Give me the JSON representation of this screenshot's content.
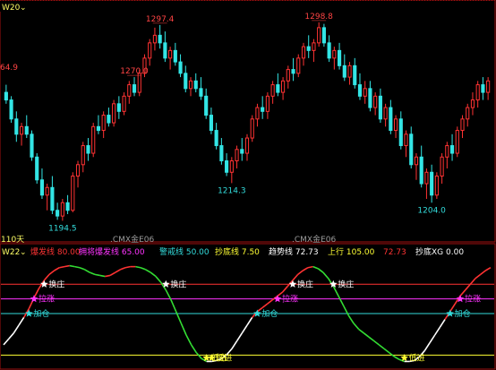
{
  "top_panel": {
    "name": "W20",
    "period_label": "110天",
    "symbol_watermark": ".CMX金E06",
    "peak_labels": [
      {
        "text": "1297.4",
        "type": "high"
      },
      {
        "text": "1298.8",
        "type": "high"
      },
      {
        "text": "1270.0",
        "type": "high"
      },
      {
        "text": "64.9",
        "type": "high"
      },
      {
        "text": "1194.5",
        "type": "low"
      },
      {
        "text": "1214.3",
        "type": "low"
      },
      {
        "text": "1204.0",
        "type": "low"
      }
    ]
  },
  "bottom_panel": {
    "name": "W22",
    "indicators": [
      {
        "label": "爆发线",
        "value": "80.00",
        "color": "#ff3333"
      },
      {
        "label": "拥将爆发线",
        "value": "65.00",
        "color": "#ff33ff"
      },
      {
        "label": "警戒线",
        "value": "50.00",
        "color": "#33dddd"
      },
      {
        "label": "抄底线",
        "value": "7.50",
        "color": "#ffff33"
      },
      {
        "label": "趋势线",
        "value": "72.73",
        "color": "#ffffff"
      },
      {
        "label": "上行",
        "value": "105.00",
        "color": "#ffff33"
      },
      {
        "label": "",
        "value": "72.73",
        "color": "#ff3333"
      },
      {
        "label": "抄底XG",
        "value": "0.00",
        "color": "#ffffff"
      }
    ],
    "levels": [
      {
        "name": "爆发线",
        "value": 80,
        "color": "#ff3333"
      },
      {
        "name": "拥将爆发线",
        "value": 65,
        "color": "#ff33ff"
      },
      {
        "name": "警戒线",
        "value": 50,
        "color": "#33dddd"
      },
      {
        "name": "抄底线",
        "value": 7.5,
        "color": "#ffff33"
      }
    ],
    "signals": [
      {
        "text": "换庄",
        "color": "#ffffff",
        "star": "#ffffff"
      },
      {
        "text": "换庄",
        "color": "#ffffff",
        "star": "#ffffff"
      },
      {
        "text": "换庄",
        "color": "#ffffff",
        "star": "#ffffff"
      },
      {
        "text": "换庄",
        "color": "#ffffff",
        "star": "#ffffff"
      },
      {
        "text": "拉涨",
        "color": "#ff33ff",
        "star": "#ff33ff"
      },
      {
        "text": "拉涨",
        "color": "#ff33ff",
        "star": "#ff33ff"
      },
      {
        "text": "拉涨",
        "color": "#ff33ff",
        "star": "#ff33ff"
      },
      {
        "text": "加仓",
        "color": "#33dddd",
        "star": "#33dddd"
      },
      {
        "text": "加仓",
        "color": "#33dddd",
        "star": "#33dddd"
      },
      {
        "text": "加仓",
        "color": "#33dddd",
        "star": "#33dddd"
      },
      {
        "text": "加仓",
        "color": "#33dddd",
        "star": "#33dddd"
      },
      {
        "text": "低进",
        "color": "#ffff33",
        "star": "#ffff33"
      },
      {
        "text": "低进",
        "color": "#ffff33",
        "star": "#ffff33"
      },
      {
        "text": "低进",
        "color": "#ffff33",
        "star": "#ffff33"
      }
    ]
  },
  "colors": {
    "up": "#ff3333",
    "down": "#33e5e5",
    "background": "#000000",
    "frame": "#a01010",
    "high_label": "#ff4444",
    "low_label": "#33dddd",
    "name_tag": "#ffff66",
    "watermark": "#9a9a9a"
  },
  "chart_data": {
    "type": "candlestick",
    "series_name": ".CMX金E06",
    "ylim": [
      1190,
      1303
    ],
    "ohlc": [
      [
        1262,
        1266,
        1256,
        1258
      ],
      [
        1258,
        1260,
        1246,
        1248
      ],
      [
        1248,
        1252,
        1236,
        1240
      ],
      [
        1240,
        1246,
        1234,
        1244
      ],
      [
        1244,
        1250,
        1238,
        1240
      ],
      [
        1240,
        1242,
        1226,
        1228
      ],
      [
        1228,
        1230,
        1214,
        1216
      ],
      [
        1216,
        1222,
        1206,
        1208
      ],
      [
        1208,
        1214,
        1200,
        1212
      ],
      [
        1212,
        1218,
        1198,
        1200
      ],
      [
        1200,
        1204,
        1195,
        1197
      ],
      [
        1197,
        1206,
        1194.5,
        1204
      ],
      [
        1204,
        1208,
        1198,
        1200
      ],
      [
        1200,
        1220,
        1199,
        1218
      ],
      [
        1218,
        1226,
        1212,
        1224
      ],
      [
        1224,
        1236,
        1220,
        1234
      ],
      [
        1234,
        1238,
        1226,
        1230
      ],
      [
        1230,
        1246,
        1228,
        1244
      ],
      [
        1244,
        1250,
        1240,
        1242
      ],
      [
        1242,
        1252,
        1238,
        1250
      ],
      [
        1250,
        1254,
        1244,
        1246
      ],
      [
        1246,
        1258,
        1244,
        1256
      ],
      [
        1256,
        1260,
        1248,
        1252
      ],
      [
        1252,
        1262,
        1250,
        1260
      ],
      [
        1260,
        1268,
        1256,
        1266
      ],
      [
        1266,
        1270,
        1260,
        1262
      ],
      [
        1262,
        1274,
        1260,
        1272
      ],
      [
        1272,
        1282,
        1270,
        1280
      ],
      [
        1280,
        1290,
        1276,
        1288
      ],
      [
        1288,
        1296,
        1284,
        1292
      ],
      [
        1292,
        1297.4,
        1285,
        1288
      ],
      [
        1288,
        1294,
        1278,
        1280
      ],
      [
        1280,
        1286,
        1274,
        1284
      ],
      [
        1284,
        1288,
        1276,
        1278
      ],
      [
        1278,
        1282,
        1270,
        1272
      ],
      [
        1272,
        1276,
        1262,
        1264
      ],
      [
        1264,
        1270,
        1260,
        1268
      ],
      [
        1268,
        1272,
        1262,
        1264
      ],
      [
        1264,
        1270,
        1258,
        1260
      ],
      [
        1260,
        1264,
        1248,
        1250
      ],
      [
        1250,
        1254,
        1240,
        1242
      ],
      [
        1242,
        1246,
        1232,
        1234
      ],
      [
        1234,
        1238,
        1224,
        1226
      ],
      [
        1226,
        1230,
        1218,
        1220
      ],
      [
        1220,
        1228,
        1214.3,
        1226
      ],
      [
        1226,
        1234,
        1222,
        1232
      ],
      [
        1232,
        1238,
        1226,
        1230
      ],
      [
        1230,
        1240,
        1226,
        1238
      ],
      [
        1238,
        1250,
        1236,
        1248
      ],
      [
        1248,
        1256,
        1244,
        1254
      ],
      [
        1254,
        1260,
        1248,
        1252
      ],
      [
        1252,
        1262,
        1248,
        1260
      ],
      [
        1260,
        1268,
        1256,
        1266
      ],
      [
        1266,
        1272,
        1260,
        1262
      ],
      [
        1262,
        1270,
        1258,
        1268
      ],
      [
        1268,
        1276,
        1264,
        1274
      ],
      [
        1274,
        1280,
        1268,
        1272
      ],
      [
        1272,
        1282,
        1270,
        1280
      ],
      [
        1280,
        1288,
        1276,
        1286
      ],
      [
        1286,
        1292,
        1280,
        1284
      ],
      [
        1284,
        1290,
        1278,
        1288
      ],
      [
        1288,
        1298.8,
        1286,
        1296
      ],
      [
        1296,
        1298,
        1286,
        1288
      ],
      [
        1288,
        1292,
        1278,
        1280
      ],
      [
        1280,
        1286,
        1274,
        1284
      ],
      [
        1284,
        1288,
        1274,
        1276
      ],
      [
        1276,
        1282,
        1268,
        1270
      ],
      [
        1270,
        1278,
        1266,
        1276
      ],
      [
        1276,
        1280,
        1264,
        1266
      ],
      [
        1266,
        1272,
        1258,
        1260
      ],
      [
        1260,
        1268,
        1256,
        1264
      ],
      [
        1264,
        1268,
        1252,
        1254
      ],
      [
        1254,
        1262,
        1250,
        1260
      ],
      [
        1260,
        1264,
        1246,
        1248
      ],
      [
        1248,
        1256,
        1244,
        1254
      ],
      [
        1254,
        1258,
        1240,
        1242
      ],
      [
        1242,
        1250,
        1238,
        1248
      ],
      [
        1248,
        1252,
        1232,
        1234
      ],
      [
        1234,
        1242,
        1228,
        1240
      ],
      [
        1240,
        1244,
        1222,
        1224
      ],
      [
        1224,
        1230,
        1216,
        1228
      ],
      [
        1228,
        1234,
        1212,
        1214
      ],
      [
        1214,
        1222,
        1206,
        1220
      ],
      [
        1220,
        1224,
        1204.0,
        1208
      ],
      [
        1208,
        1220,
        1206,
        1218
      ],
      [
        1218,
        1230,
        1214,
        1228
      ],
      [
        1228,
        1236,
        1222,
        1234
      ],
      [
        1234,
        1240,
        1226,
        1230
      ],
      [
        1230,
        1244,
        1228,
        1242
      ],
      [
        1242,
        1250,
        1238,
        1248
      ],
      [
        1248,
        1256,
        1244,
        1254
      ],
      [
        1254,
        1262,
        1250,
        1258
      ],
      [
        1258,
        1268,
        1254,
        1266
      ],
      [
        1266,
        1270,
        1258,
        1262
      ],
      [
        1262,
        1270,
        1258,
        1268
      ]
    ],
    "indicator_ylim": [
      -5,
      105
    ],
    "indicator_line": [
      18,
      24,
      30,
      38,
      46,
      55,
      66,
      76,
      84,
      90,
      94,
      97,
      98,
      99,
      98,
      97,
      95,
      92,
      90,
      89,
      88,
      89,
      92,
      95,
      97,
      98,
      98,
      97,
      95,
      92,
      88,
      82,
      74,
      64,
      52,
      40,
      28,
      18,
      10,
      4,
      1,
      1,
      2,
      4,
      8,
      14,
      22,
      30,
      38,
      46,
      52,
      56,
      60,
      64,
      68,
      72,
      78,
      84,
      90,
      94,
      97,
      98,
      96,
      92,
      86,
      78,
      68,
      58,
      48,
      40,
      34,
      30,
      26,
      22,
      18,
      14,
      10,
      6,
      3,
      1,
      1,
      2,
      6,
      12,
      20,
      28,
      36,
      44,
      52,
      60,
      68,
      74,
      80,
      86,
      90,
      94,
      97
    ]
  }
}
